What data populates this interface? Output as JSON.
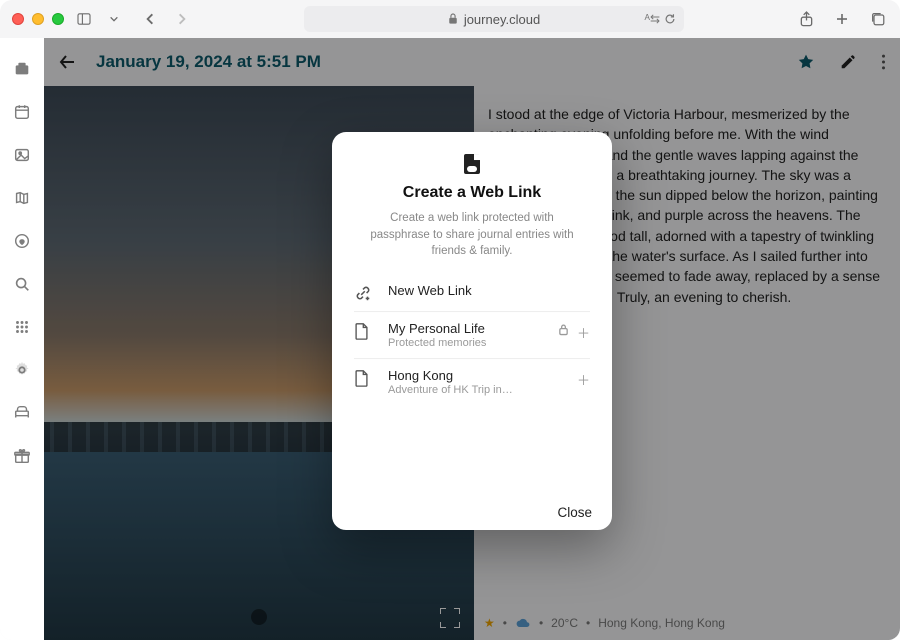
{
  "browser": {
    "url_host": "journey.cloud"
  },
  "entry": {
    "title": "January 19, 2024 at 5:51 PM",
    "body": "I stood at the edge of Victoria Harbour, mesmerized by the enchanting evening unfolding before me. With the wind caressing my face and the gentle waves lapping against the boat, I embarked on a breathtaking journey. The sky was a canvas of colors, as the sun dipped below the horizon, painting streaks of orange, pink, and purple across the heavens. The towering skyline stood tall, adorned with a tapestry of twinkling lights, reflecting off the water's surface. As I sailed further into the harbour, the city seemed to fade away, replaced by a sense of serenity and awe. Truly, an evening to cherish.",
    "footer": {
      "temp": "20°C",
      "location": "Hong Kong, Hong Kong",
      "separator": "•"
    }
  },
  "modal": {
    "title": "Create a Web Link",
    "subtitle": "Create a web link protected with passphrase to share journal entries with friends & family.",
    "new_link_label": "New Web Link",
    "links": [
      {
        "title": "My Personal Life",
        "subtitle": "Protected memories",
        "locked": true
      },
      {
        "title": "Hong Kong",
        "subtitle": "Adventure of HK Trip in…",
        "locked": false
      }
    ],
    "close_label": "Close"
  }
}
